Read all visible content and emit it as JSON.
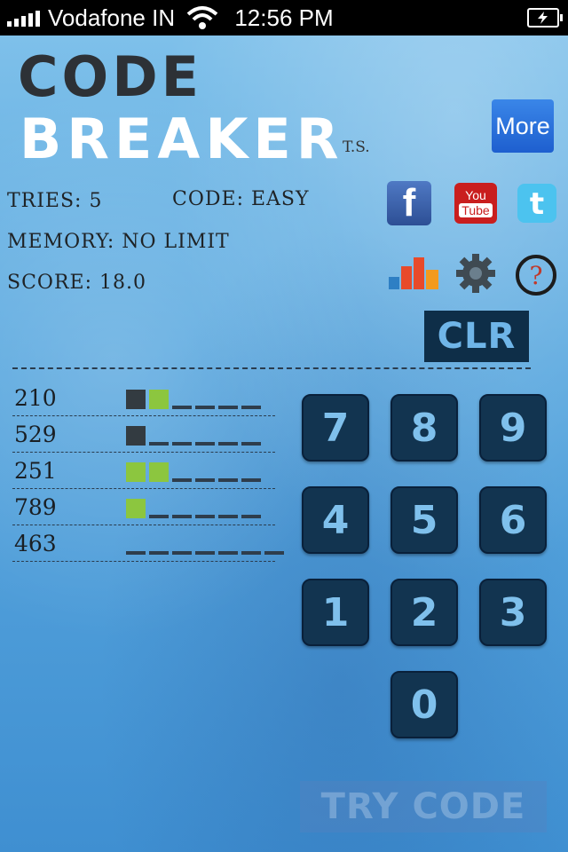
{
  "status_bar": {
    "carrier": "Vodafone IN",
    "time": "12:56 PM"
  },
  "title": {
    "line1": "CODE",
    "line2": "BREAKER",
    "suffix": "T.S."
  },
  "more_button": "More",
  "stats": {
    "tries": "TRIES: 5",
    "code": "CODE: EASY",
    "memory": "MEMORY: NO LIMIT",
    "score": "SCORE: 18.0"
  },
  "social": {
    "facebook_glyph": "f",
    "youtube_top": "You",
    "youtube_bottom": "Tube"
  },
  "clear_button": "CLR",
  "history": [
    {
      "guess": "210",
      "marks": [
        "black",
        "green",
        "empty",
        "empty",
        "empty",
        "empty"
      ]
    },
    {
      "guess": "529",
      "marks": [
        "black",
        "empty",
        "empty",
        "empty",
        "empty",
        "empty"
      ]
    },
    {
      "guess": "251",
      "marks": [
        "green",
        "green",
        "empty",
        "empty",
        "empty",
        "empty"
      ]
    },
    {
      "guess": "789",
      "marks": [
        "green",
        "empty",
        "empty",
        "empty",
        "empty",
        "empty"
      ]
    },
    {
      "guess": "463",
      "marks": [
        "empty",
        "empty",
        "empty",
        "empty",
        "empty",
        "empty",
        "empty"
      ]
    }
  ],
  "keypad": [
    "7",
    "8",
    "9",
    "4",
    "5",
    "6",
    "1",
    "2",
    "3",
    "0"
  ],
  "try_button": "TRY CODE",
  "colors": {
    "background": "#4fa3dc",
    "key": "#123450",
    "black_peg": "#333b41",
    "green_peg": "#8cc63f"
  }
}
